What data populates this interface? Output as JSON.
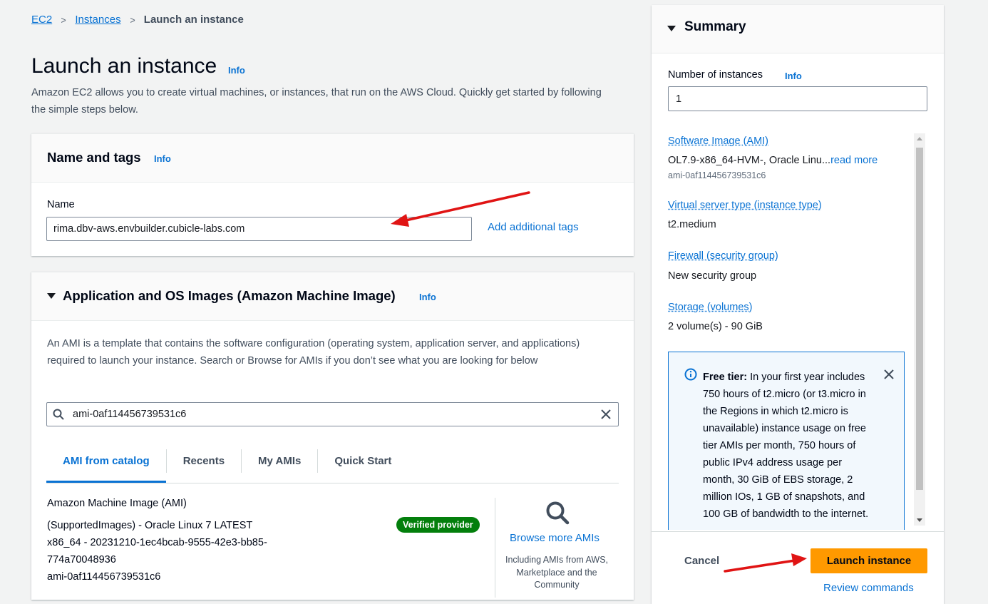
{
  "breadcrumb": {
    "items": [
      "EC2",
      "Instances"
    ],
    "current": "Launch an instance",
    "separator": ">"
  },
  "page": {
    "title": "Launch an instance",
    "info": "Info",
    "description": "Amazon EC2 allows you to create virtual machines, or instances, that run on the AWS Cloud. Quickly get started by following the simple steps below."
  },
  "name_tags": {
    "heading": "Name and tags",
    "info": "Info",
    "name_label": "Name",
    "name_value": "rima.dbv-aws.envbuilder.cubicle-labs.com",
    "add_tags": "Add additional tags"
  },
  "ami": {
    "heading": "Application and OS Images (Amazon Machine Image)",
    "info": "Info",
    "description": "An AMI is a template that contains the software configuration (operating system, application server, and applications) required to launch your instance. Search or Browse for AMIs if you don’t see what you are looking for below",
    "search_value": "ami-0af114456739531c6",
    "tabs": [
      {
        "label": "AMI from catalog",
        "active": true
      },
      {
        "label": "Recents",
        "active": false
      },
      {
        "label": "My AMIs",
        "active": false
      },
      {
        "label": "Quick Start",
        "active": false
      }
    ],
    "result_title": "Amazon Machine Image (AMI)",
    "result_line1": "(SupportedImages) - Oracle Linux 7 LATEST",
    "result_line2": "x86_64 - 20231210-1ec4bcab-9555-42e3-bb85-",
    "result_line3": "774a70048936",
    "result_line4": "ami-0af114456739531c6",
    "badge": "Verified provider",
    "browse_link": "Browse more AMIs",
    "browse_sub": "Including AMIs from AWS, Marketplace and the Community"
  },
  "summary": {
    "heading": "Summary",
    "num_instances_label": "Number of instances",
    "info": "Info",
    "num_instances": "1",
    "software_image_label": "Software Image (AMI)",
    "software_image_value": "OL7.9-x86_64-HVM-, Oracle Linu...",
    "read_more": "read more",
    "software_image_id": "ami-0af114456739531c6",
    "server_type_label": "Virtual server type (instance type)",
    "server_type_value": "t2.medium",
    "firewall_label": "Firewall (security group)",
    "firewall_value": "New security group",
    "storage_label": "Storage (volumes)",
    "storage_value": "2 volume(s) - 90 GiB",
    "free_tier_bold": "Free tier:",
    "free_tier_text": " In your first year includes 750 hours of t2.micro (or t3.micro in the Regions in which t2.micro is unavailable) instance usage on free tier AMIs per month, 750 hours of public IPv4 address usage per month, 30 GiB of EBS storage, 2 million IOs, 1 GB of snapshots, and 100 GB of bandwidth to the internet.",
    "cancel": "Cancel",
    "launch": "Launch instance",
    "review": "Review commands"
  },
  "colors": {
    "accent": "#0972d3",
    "primary_button": "#ff9900",
    "badge": "#037f0c",
    "annotation_arrow": "#e01414"
  }
}
